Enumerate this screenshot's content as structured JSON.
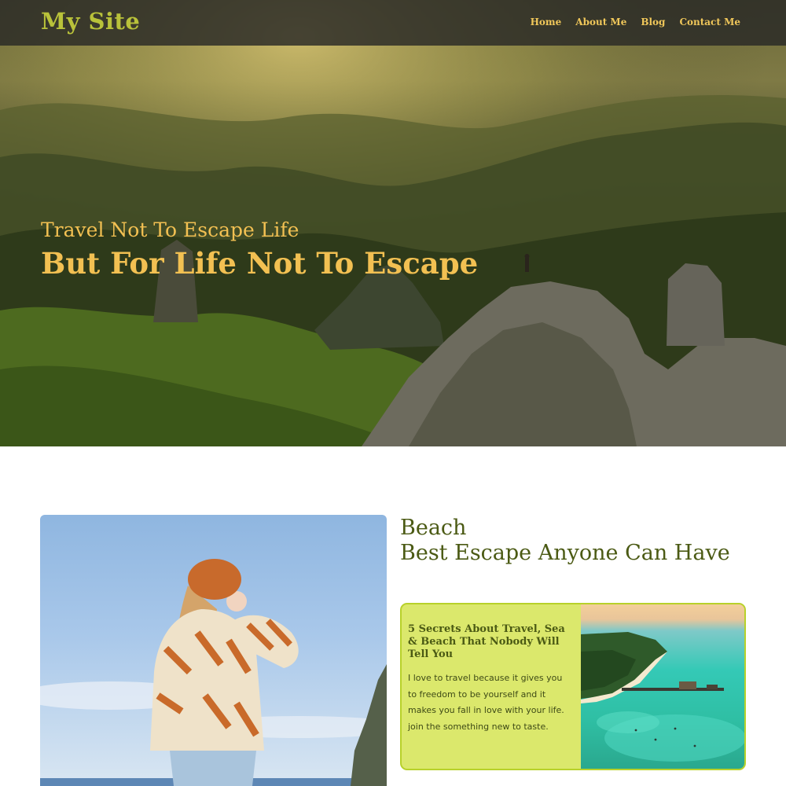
{
  "header": {
    "logo": "My Site",
    "nav": [
      "Home",
      "About Me",
      "Blog",
      "Contact Me"
    ]
  },
  "hero": {
    "tagline_line1": "Travel Not To Escape Life",
    "tagline_line2": "But For Life Not To Escape",
    "image": "mountain-landscape-photo"
  },
  "feature": {
    "image": "woman-in-beret-sky-photo",
    "title_line1": "Beach",
    "title_line2": "Best Escape Anyone Can Have",
    "card": {
      "title": "5 Secrets About Travel, Sea & Beach That Nobody Will Tell You",
      "text": "I love to travel because it gives you to freedom to be yourself and it makes you fall in love with your life. join the something new to taste.",
      "image": "tropical-beach-pier-photo"
    }
  },
  "colors": {
    "accent_gold": "#f2c052",
    "logo_olive": "#b9c23a",
    "heading_olive": "#4b5a14",
    "card_bg": "#dbe86c",
    "card_border": "#b8d12a"
  }
}
